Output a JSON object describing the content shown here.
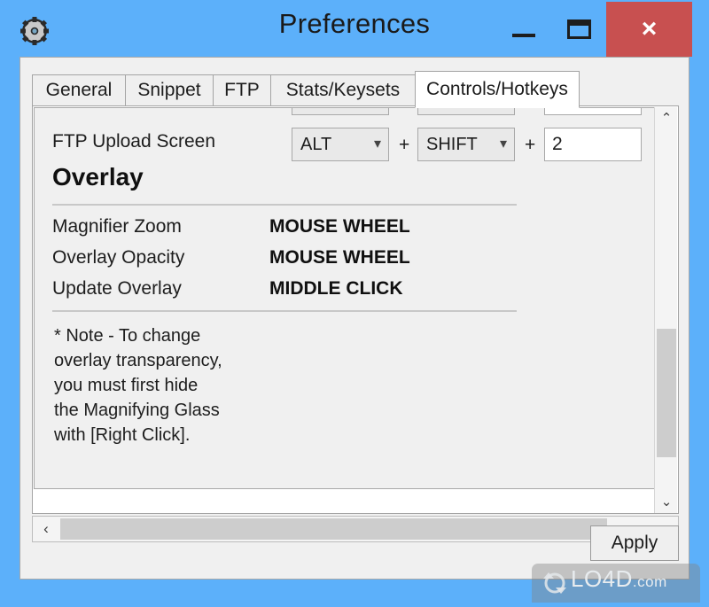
{
  "window": {
    "title": "Preferences",
    "app_icon": "gear-icon",
    "controls": {
      "minimize": "minimize-icon",
      "maximize": "maximize-icon",
      "close_label": "×"
    },
    "colors": {
      "titlebar": "#5cb0fa",
      "close_button": "#c85050",
      "dialog_body": "#f0f0f0",
      "panel": "#ffffff",
      "scroll_thumb": "#cdcdcd"
    }
  },
  "tabs": [
    {
      "label": "General",
      "active": false
    },
    {
      "label": "Snippet",
      "active": false
    },
    {
      "label": "FTP",
      "active": false
    },
    {
      "label": "Stats/Keysets",
      "active": false
    },
    {
      "label": "Controls/Hotkeys",
      "active": true
    }
  ],
  "hotkeys": {
    "rows": [
      {
        "label": "FTP Upload Screen",
        "modifier1": "ALT",
        "plus1": "+",
        "modifier2": "SHIFT",
        "plus2": "+",
        "key": "2"
      }
    ]
  },
  "section": {
    "heading": "Overlay",
    "actions": [
      {
        "label": "Magnifier Zoom",
        "value": "MOUSE WHEEL"
      },
      {
        "label": "Overlay Opacity",
        "value": "MOUSE WHEEL"
      },
      {
        "label": "Update Overlay",
        "value": "MIDDLE CLICK"
      }
    ],
    "note": "* Note - To change\noverlay transparency,\nyou must first hide\nthe Magnifying Glass\nwith [Right Click]."
  },
  "scrollbars": {
    "vertical": {
      "up": "⌃",
      "down": "⌄"
    },
    "horizontal": {
      "left": "‹",
      "right": "›"
    }
  },
  "footer": {
    "apply_label": "Apply"
  },
  "watermark": {
    "text": "LO4D",
    "suffix": ".com"
  }
}
